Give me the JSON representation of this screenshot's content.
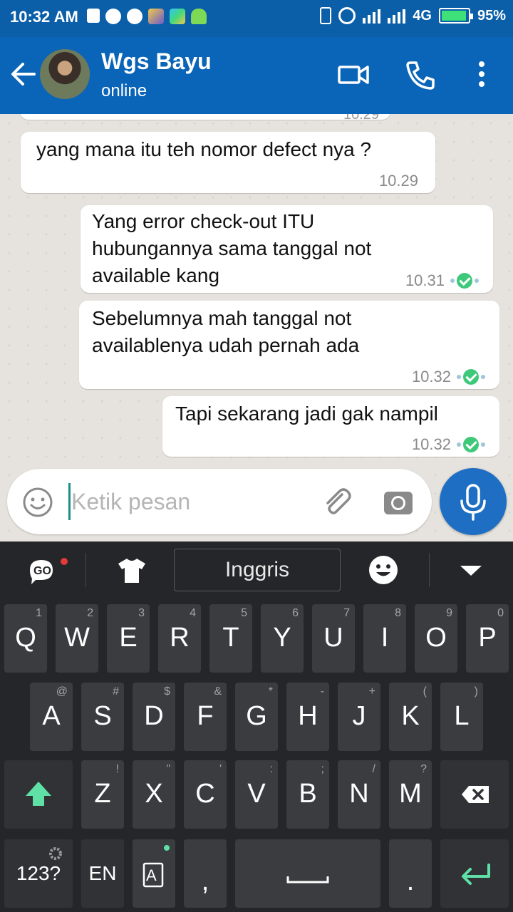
{
  "status_bar": {
    "time": "10:32 AM",
    "network": "4G",
    "battery": "95%",
    "battery_level": 0.95
  },
  "header": {
    "contact_name": "Wgs Bayu",
    "contact_status": "online",
    "icons": [
      "back-arrow-icon",
      "video-call-icon",
      "phone-icon",
      "more-vert-icon"
    ]
  },
  "chat": {
    "previous_time": "10.29",
    "messages": [
      {
        "direction": "incoming",
        "text": "yang mana itu teh nomor defect nya ?",
        "time": "10.29"
      },
      {
        "direction": "outgoing",
        "lines": [
          "Yang error check-out ITU",
          "hubungannya sama tanggal not",
          "available kang"
        ],
        "time": "10.31"
      },
      {
        "direction": "outgoing",
        "lines": [
          "Sebelumnya mah tanggal not",
          "availablenya udah pernah ada"
        ],
        "time": "10.32"
      },
      {
        "direction": "outgoing",
        "text": "Tapi sekarang jadi gak nampil",
        "time": "10.32"
      }
    ]
  },
  "composer": {
    "placeholder": "Ketik pesan",
    "value": ""
  },
  "keyboard": {
    "language": "Inggris",
    "row1": [
      {
        "k": "Q",
        "s": "1"
      },
      {
        "k": "W",
        "s": "2"
      },
      {
        "k": "E",
        "s": "3"
      },
      {
        "k": "R",
        "s": "4"
      },
      {
        "k": "T",
        "s": "5"
      },
      {
        "k": "Y",
        "s": "6"
      },
      {
        "k": "U",
        "s": "7"
      },
      {
        "k": "I",
        "s": "8"
      },
      {
        "k": "O",
        "s": "9"
      },
      {
        "k": "P",
        "s": "0"
      }
    ],
    "row2": [
      {
        "k": "A",
        "s": "@"
      },
      {
        "k": "S",
        "s": "#"
      },
      {
        "k": "D",
        "s": "$"
      },
      {
        "k": "F",
        "s": "&"
      },
      {
        "k": "G",
        "s": "*"
      },
      {
        "k": "H",
        "s": "-"
      },
      {
        "k": "J",
        "s": "+"
      },
      {
        "k": "K",
        "s": "("
      },
      {
        "k": "L",
        "s": ")"
      }
    ],
    "row3": [
      {
        "k": "Z",
        "s": "!"
      },
      {
        "k": "X",
        "s": "\""
      },
      {
        "k": "C",
        "s": "'"
      },
      {
        "k": "V",
        "s": ":"
      },
      {
        "k": "B",
        "s": ";"
      },
      {
        "k": "N",
        "s": "/"
      },
      {
        "k": "M",
        "s": "?"
      }
    ],
    "symbols_key": "123?",
    "lang_key": "EN",
    "comma_key": ",",
    "period_key": ".",
    "accent_color": "#5fe0a6"
  }
}
